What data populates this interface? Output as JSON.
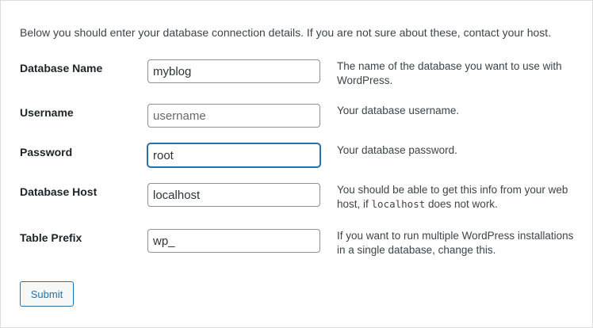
{
  "intro": "Below you should enter your database connection details. If you are not sure about these, contact your host.",
  "fields": [
    {
      "label": "Database Name",
      "value": "myblog",
      "placeholder": "",
      "description": "The name of the database you want to use with WordPress."
    },
    {
      "label": "Username",
      "value": "",
      "placeholder": "username",
      "description": "Your database username."
    },
    {
      "label": "Password",
      "value": "root",
      "placeholder": "",
      "description": "Your database password."
    },
    {
      "label": "Database Host",
      "value": "localhost",
      "placeholder": "",
      "description_pre": "You should be able to get this info from your web host, if ",
      "description_code": "localhost",
      "description_post": " does not work."
    },
    {
      "label": "Table Prefix",
      "value": "wp_",
      "placeholder": "",
      "description": "If you want to run multiple WordPress installations in a single database, change this."
    }
  ],
  "submit_label": "Submit",
  "colors": {
    "accent": "#2271b1",
    "border": "#8c8f94",
    "text": "#3c434a"
  }
}
